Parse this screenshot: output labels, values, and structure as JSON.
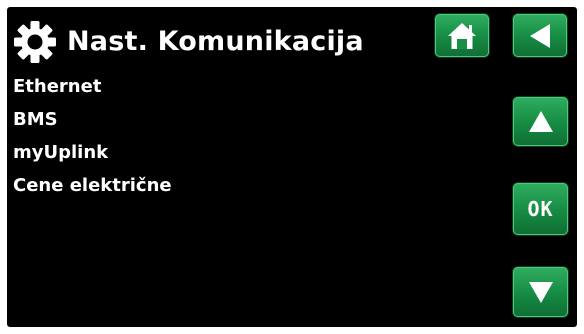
{
  "header": {
    "icon": "gear-icon",
    "title": "Nast. Komunikacija"
  },
  "menu": {
    "items": [
      {
        "label": "Ethernet"
      },
      {
        "label": "BMS"
      },
      {
        "label": "myUplink"
      },
      {
        "label": "Cene električne"
      }
    ]
  },
  "buttons": {
    "home_icon": "home-icon",
    "back_icon": "back-arrow-icon",
    "up_icon": "up-arrow-icon",
    "ok_label": "OK",
    "down_icon": "down-arrow-icon"
  },
  "colors": {
    "background": "#000000",
    "button_green": "#1c9a4d",
    "text": "#ffffff"
  }
}
